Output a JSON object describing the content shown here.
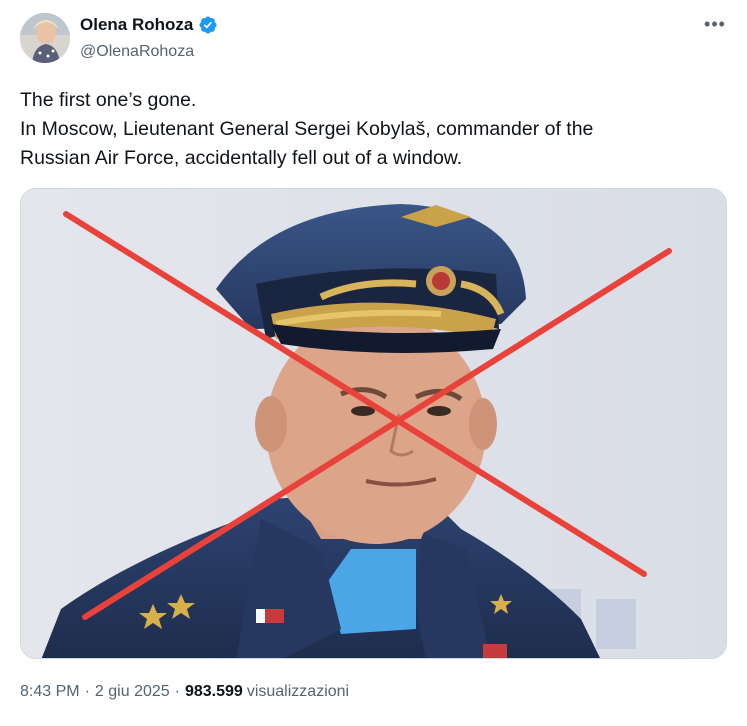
{
  "author": {
    "display_name": "Olena Rohoza",
    "handle": "@OlenaRohoza",
    "verified": true,
    "avatar_icon": "profile-photo"
  },
  "more_icon": "more-horizontal-icon",
  "post": {
    "lines": [
      "The first one’s gone.",
      "In Moscow, Lieutenant General Sergei Kobylaš, commander of the",
      "Russian Air Force, accidentally fell out of a window."
    ]
  },
  "media": {
    "description_icon": "photo-crossed-out",
    "cross_color": "#e8423a"
  },
  "meta": {
    "time": "8:43 PM",
    "date": "2 giu 2025",
    "views_count": "983.599",
    "views_label": "visualizzazioni",
    "separator": "·"
  },
  "colors": {
    "verified_badge": "#1d9bf0",
    "secondary_text": "#536471",
    "primary_text": "#0f1419"
  }
}
